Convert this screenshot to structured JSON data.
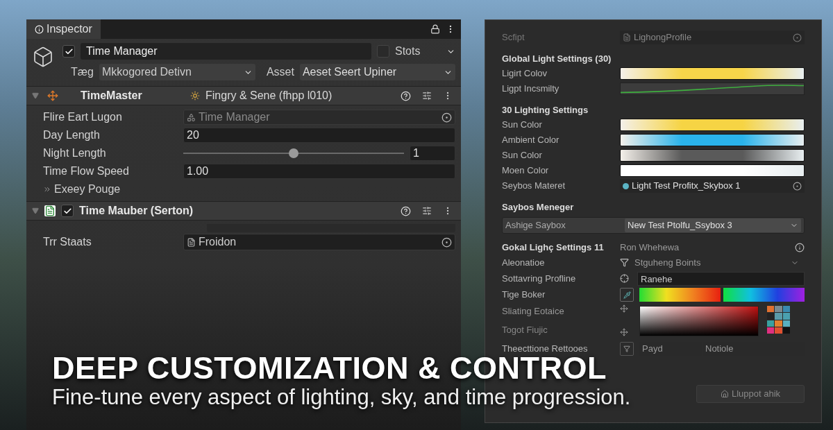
{
  "inspector": {
    "title": "Inspector",
    "object": {
      "name": "Time Manager",
      "active": true,
      "static_label": "Stots",
      "static_checked": false,
      "tag_label": "Tæg",
      "tag_value": "Mkkogored Detivn",
      "asset_label": "Asset",
      "asset_value": "Aeset Seert Upiner"
    },
    "components": [
      {
        "title": "TimeMaster",
        "script": "Fingry & Sene (fhpp l010)",
        "expanded": true,
        "fields": [
          {
            "kind": "object",
            "label": "Flire Eart Lugon",
            "value": "Time Manager"
          },
          {
            "kind": "number",
            "label": "Day Length",
            "value": "20"
          },
          {
            "kind": "slider",
            "label": "Night Length",
            "level": 0.5,
            "value": "1"
          },
          {
            "kind": "number",
            "label": "Time Flow Speed",
            "value": "1.00"
          },
          {
            "kind": "foldout",
            "label": "Exeey Pouge"
          }
        ]
      },
      {
        "title": "Time Mauber (Serton)",
        "enabled": true,
        "expanded": true,
        "fields": [
          {
            "kind": "blurred"
          },
          {
            "kind": "file",
            "label": "Trr Staats",
            "value": "Froidon"
          }
        ]
      }
    ]
  },
  "profile": {
    "script_label": "Scfipt",
    "script_value": "LighongProfile",
    "sections": [
      {
        "title": "Global Light Settings (30)",
        "rows": [
          {
            "kind": "gradient",
            "label": "Ligirt Colov",
            "color": "#f7d54a"
          },
          {
            "kind": "curve",
            "label": "Ligpt Incsmilty"
          }
        ]
      },
      {
        "title": "30 Lighting Settings",
        "rows": [
          {
            "kind": "gradient",
            "label": "Sun Color",
            "color": "#f6d444"
          },
          {
            "kind": "gradient",
            "label": "Ambient Color",
            "color": "#2ab3ea"
          },
          {
            "kind": "gradient",
            "label": "Sun Color",
            "color": "#5a5a5a"
          },
          {
            "kind": "gradient",
            "label": "Moen Color",
            "color": "#ffffff"
          },
          {
            "kind": "object",
            "label": "Seybos Materet",
            "value": "Light Test Profitx_Skybox 1"
          }
        ]
      },
      {
        "title": "Saybos Meneger",
        "rows": [
          {
            "kind": "dropdown_box",
            "label": "Ashige Saybox",
            "value": "New Test Ptolfu_Ssybox 3"
          }
        ]
      },
      {
        "title": "Gokal Lighç Settings 11",
        "note": "Ron Whehewa",
        "rows": [
          {
            "kind": "dropdown",
            "label": "Aleonatioe",
            "value": "Stguheng Boints"
          },
          {
            "kind": "text",
            "label": "Sottavring Profline",
            "value": "Ranehe"
          },
          {
            "kind": "rainbow",
            "label": "Tige Boker"
          },
          {
            "kind": "picker",
            "label": "Sliating Eotaice",
            "label2": "Togot Fiujic"
          },
          {
            "kind": "pair",
            "label": "Theecttione Rettooes",
            "values": [
              "Payd",
              "Notiole"
            ]
          }
        ]
      }
    ],
    "button": "Lluppot ahik"
  },
  "headline": "DEEP CUSTOMIZATION & CONTROL",
  "subtitle": "Fine-tune every aspect of lighting, sky, and time progression."
}
